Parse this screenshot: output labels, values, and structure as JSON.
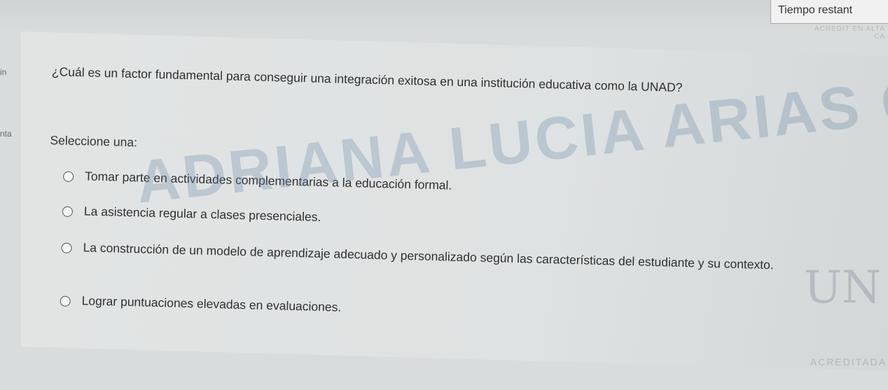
{
  "header": {
    "timer_label": "Tiempo restant",
    "accreditation_badge": "ACREDIT EN ALTA CA"
  },
  "sidebar": {
    "fragment_1": "in",
    "fragment_2": "nta"
  },
  "question": {
    "text": "¿Cuál es un factor fundamental para conseguir una integración exitosa en una institución educativa como la UNAD?",
    "prompt": "Seleccione una:",
    "options": [
      {
        "label": "Tomar parte en actividades complementarias a la educación formal."
      },
      {
        "label": "La asistencia regular a clases presenciales."
      },
      {
        "label": "La construcción de un modelo de aprendizaje adecuado y personalizado según las características del estudiante y su contexto."
      },
      {
        "label": "Lograr puntuaciones elevadas en evaluaciones."
      }
    ]
  },
  "watermark": {
    "text": "ADRIANA LUCIA ARIAS GIL"
  },
  "seal": {
    "letters": "UN",
    "accreditation": "ACREDITADA"
  }
}
